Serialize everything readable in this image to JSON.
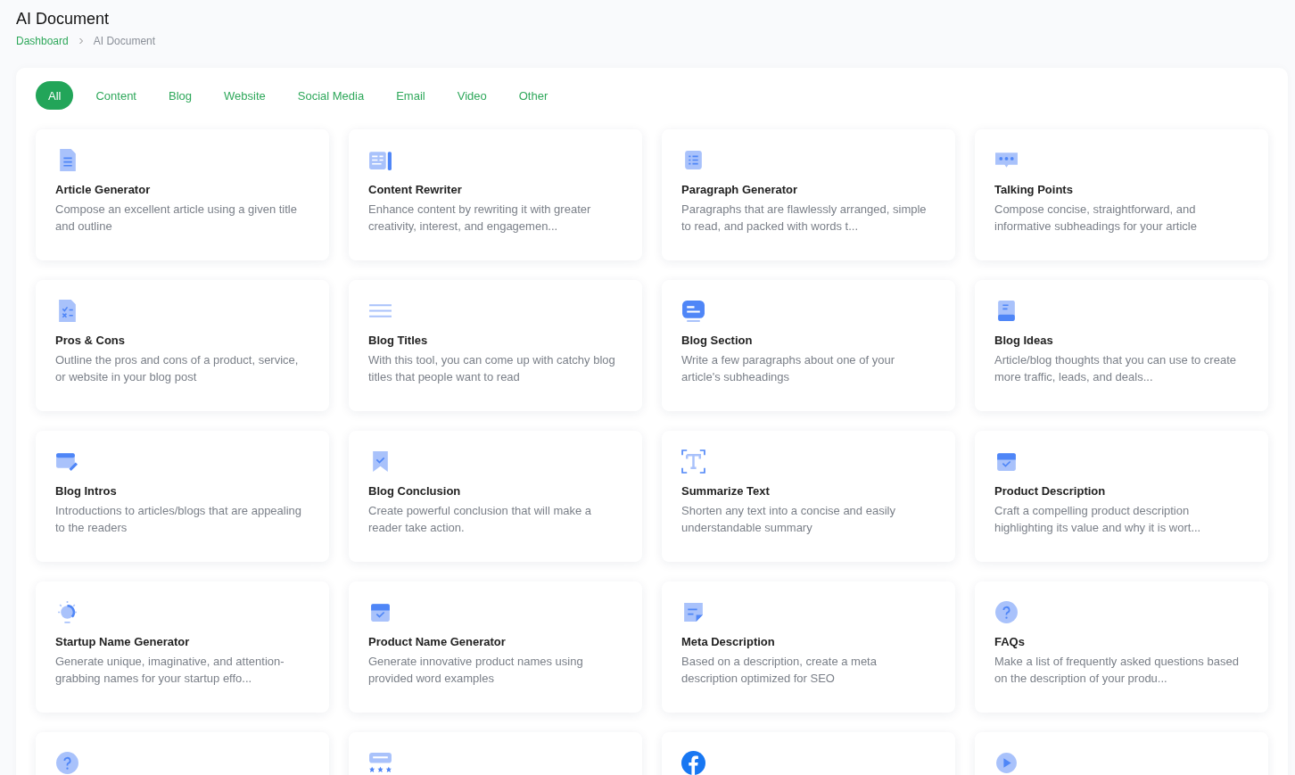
{
  "page": {
    "title": "AI Document"
  },
  "breadcrumb": [
    {
      "label": "Dashboard",
      "kind": "link"
    },
    {
      "label": "AI Document",
      "kind": "current"
    }
  ],
  "tabs": [
    {
      "label": "All",
      "selected": true
    },
    {
      "label": "Content",
      "selected": false
    },
    {
      "label": "Blog",
      "selected": false
    },
    {
      "label": "Website",
      "selected": false
    },
    {
      "label": "Social Media",
      "selected": false
    },
    {
      "label": "Email",
      "selected": false
    },
    {
      "label": "Video",
      "selected": false
    },
    {
      "label": "Other",
      "selected": false
    }
  ],
  "cards": [
    {
      "kind": "document",
      "title": "Article Generator",
      "description": "Compose an excellent article using a given title and outline"
    },
    {
      "kind": "rewrite",
      "title": "Content Rewriter",
      "description": "Enhance content by rewriting it with greater creativity, interest, and engagemen..."
    },
    {
      "kind": "checklist",
      "title": "Paragraph Generator",
      "description": "Paragraphs that are flawlessly arranged, simple to read, and packed with words t..."
    },
    {
      "kind": "chat",
      "title": "Talking Points",
      "description": "Compose concise, straightforward, and informative subheadings for your article"
    },
    {
      "kind": "proscons",
      "title": "Pros & Cons",
      "description": "Outline the pros and cons of a product, service, or website in your blog post"
    },
    {
      "kind": "lines",
      "title": "Blog Titles",
      "description": "With this tool, you can come up with catchy blog titles that people want to read"
    },
    {
      "kind": "message",
      "title": "Blog Section",
      "description": "Write a few paragraphs about one of your article's subheadings"
    },
    {
      "kind": "book",
      "title": "Blog Ideas",
      "description": "Article/blog thoughts that you can use to create more traffic, leads, and deals..."
    },
    {
      "kind": "edit",
      "title": "Blog Intros",
      "description": "Introductions to articles/blogs that are appealing to the readers"
    },
    {
      "kind": "bookmark",
      "title": "Blog Conclusion",
      "description": "Create powerful conclusion that will make a reader take action."
    },
    {
      "kind": "text",
      "title": "Summarize Text",
      "description": "Shorten any text into a concise and easily understandable summary"
    },
    {
      "kind": "box",
      "title": "Product Description",
      "description": "Craft a compelling product description highlighting its value and why it is wort..."
    },
    {
      "kind": "bulb",
      "title": "Startup Name Generator",
      "description": "Generate unique, imaginative, and attention-grabbing names for your startup effo..."
    },
    {
      "kind": "box",
      "title": "Product Name Generator",
      "description": "Generate innovative product names using provided word examples"
    },
    {
      "kind": "note",
      "title": "Meta Description",
      "description": "Based on a description, create a meta description optimized for SEO"
    },
    {
      "kind": "question",
      "title": "FAQs",
      "description": "Make a list of frequently asked questions based on the description of your produ..."
    },
    {
      "kind": "question"
    },
    {
      "kind": "review"
    },
    {
      "kind": "facebook"
    },
    {
      "kind": "play"
    }
  ]
}
